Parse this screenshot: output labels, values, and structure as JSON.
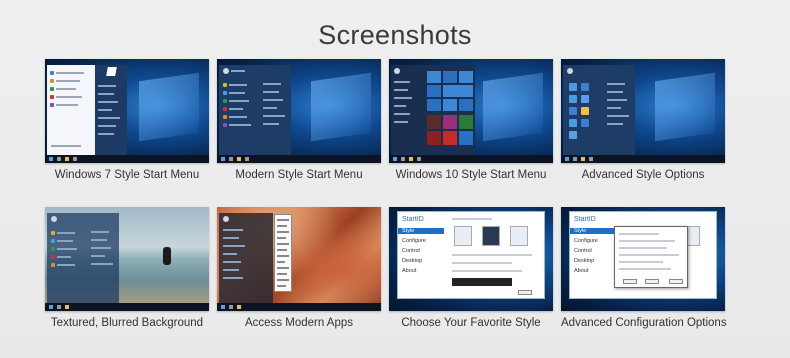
{
  "page": {
    "title": "Screenshots"
  },
  "screenshots": [
    {
      "caption": "Windows 7 Style Start Menu"
    },
    {
      "caption": "Modern Style Start Menu"
    },
    {
      "caption": "Windows 10 Style Start Menu"
    },
    {
      "caption": "Advanced Style Options"
    },
    {
      "caption": "Textured, Blurred Background"
    },
    {
      "caption": "Access Modern Apps"
    },
    {
      "caption": "Choose Your Favorite Style"
    },
    {
      "caption": "Advanced Configuration Options"
    }
  ],
  "settings_app": {
    "logo": "StartID",
    "nav": [
      "Style",
      "Configure",
      "Control",
      "Desktop",
      "About"
    ]
  },
  "colors": {
    "background": "#ececec",
    "win_blue": "#0f4a91",
    "menu_dark": "#1c3a63",
    "accent": "#1e6fc8"
  }
}
